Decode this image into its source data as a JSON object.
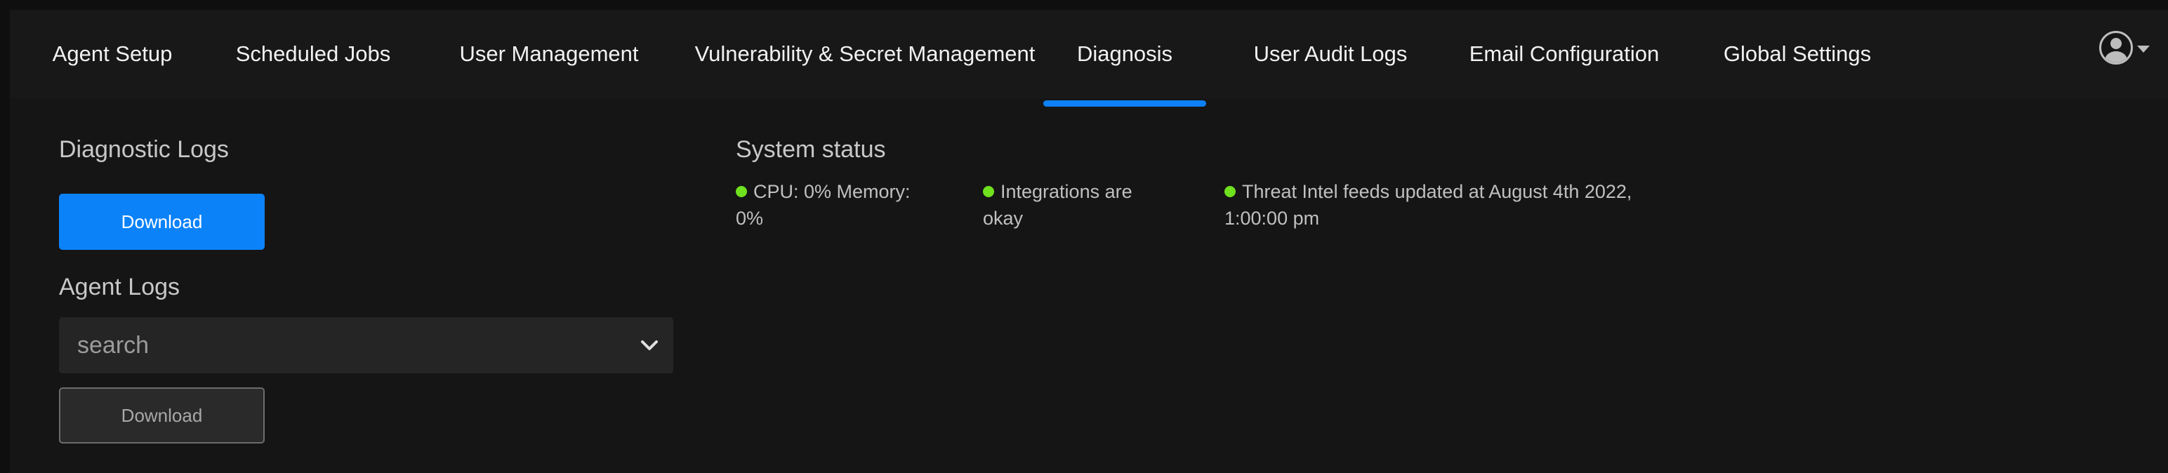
{
  "nav": {
    "tabs": [
      {
        "label": "Agent Setup"
      },
      {
        "label": "Scheduled Jobs"
      },
      {
        "label": "User Management"
      },
      {
        "label": "Vulnerability & Secret Management"
      },
      {
        "label": "Diagnosis",
        "active": true
      },
      {
        "label": "User Audit Logs"
      },
      {
        "label": "Email Configuration"
      },
      {
        "label": "Global Settings"
      }
    ],
    "user_icon": "user-avatar-icon",
    "dropdown_icon": "caret-down-icon"
  },
  "diagnostic_logs": {
    "title": "Diagnostic Logs",
    "download_label": "Download"
  },
  "agent_logs": {
    "title": "Agent Logs",
    "select_placeholder": "search",
    "download_label": "Download"
  },
  "system_status": {
    "title": "System status",
    "items": [
      {
        "text": "CPU: 0% Memory: 0%",
        "status": "ok"
      },
      {
        "text": "Integrations are okay",
        "status": "ok"
      },
      {
        "text": "Threat Intel feeds updated at August 4th 2022, 1:00:00 pm",
        "status": "ok"
      }
    ]
  },
  "colors": {
    "accent": "#0b82f8",
    "status_ok": "#6fe11f",
    "background": "#151515"
  }
}
